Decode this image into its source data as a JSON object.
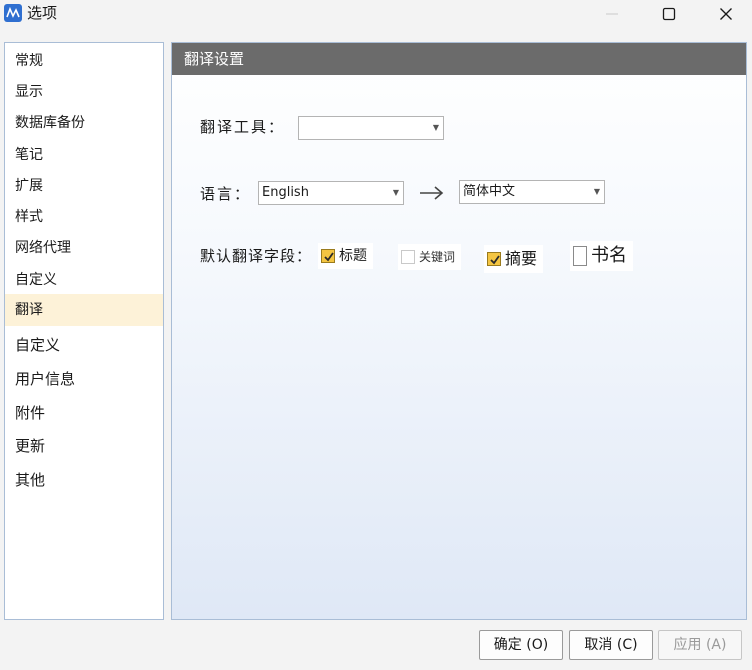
{
  "window": {
    "title": "选项",
    "icon": "app-logo-icon",
    "controls": [
      "minimize-icon",
      "maximize-icon",
      "close-icon"
    ]
  },
  "sidebar": {
    "items": [
      {
        "label": "常规"
      },
      {
        "label": "显示"
      },
      {
        "label": "数据库备份"
      },
      {
        "label": "笔记"
      },
      {
        "label": "扩展"
      },
      {
        "label": "样式"
      },
      {
        "label": "网络代理"
      },
      {
        "label": "自定义"
      },
      {
        "label": "翻译",
        "selected": true
      },
      {
        "label": "自定义"
      },
      {
        "label": "用户信息"
      },
      {
        "label": "附件"
      },
      {
        "label": "更新"
      },
      {
        "label": "其他"
      }
    ]
  },
  "panel": {
    "header": "翻译设置",
    "tool_label": "翻译工具：",
    "tool_value": "",
    "language_label": "语言：",
    "source_language": "English",
    "target_language": "简体中文",
    "fields_label": "默认翻译字段：",
    "fields": [
      {
        "label": "标题",
        "checked": true
      },
      {
        "label": "关键词",
        "checked": false
      },
      {
        "label": "摘要",
        "checked": true
      },
      {
        "label": "书名",
        "checked": false
      }
    ]
  },
  "buttons": {
    "ok": "确定 (O)",
    "cancel": "取消 (C)",
    "apply": "应用 (A)",
    "apply_enabled": false
  },
  "colors": {
    "header_bg": "#6b6b6b",
    "selected_nav_bg": "#fdf2d8",
    "checkbox_checked": "#f4c542",
    "app_icon": "#2f6fd0"
  }
}
